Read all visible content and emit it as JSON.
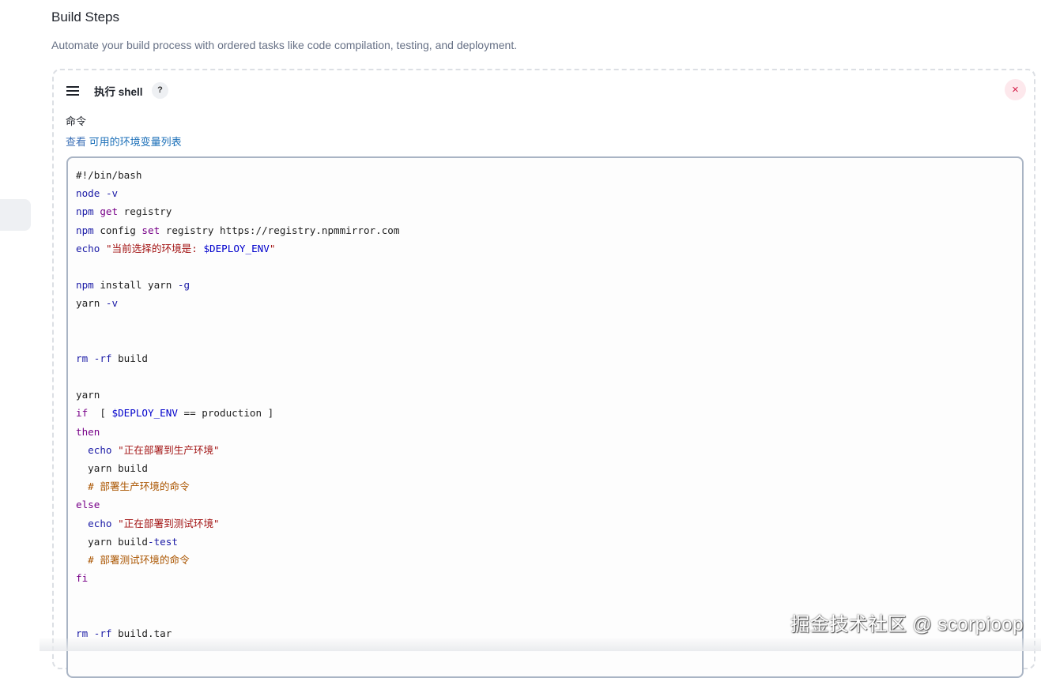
{
  "section": {
    "title": "Build Steps",
    "description": "Automate your build process with ordered tasks like code compilation, testing, and deployment."
  },
  "step": {
    "title": "执行 shell",
    "help_label": "?",
    "close_label": "×",
    "command_label": "命令",
    "env_link_prefix": "查看 ",
    "env_link_text": "可用的环境变量列表"
  },
  "code": {
    "lines": [
      [
        {
          "t": "#!/bin/bash",
          "c": "plain"
        }
      ],
      [
        {
          "t": "node",
          "c": "kw-blue"
        },
        {
          "t": " ",
          "c": "plain"
        },
        {
          "t": "-v",
          "c": "kw-blue"
        }
      ],
      [
        {
          "t": "npm",
          "c": "kw-blue"
        },
        {
          "t": " ",
          "c": "plain"
        },
        {
          "t": "get",
          "c": "kw-purple"
        },
        {
          "t": " registry",
          "c": "plain"
        }
      ],
      [
        {
          "t": "npm",
          "c": "kw-blue"
        },
        {
          "t": " config ",
          "c": "plain"
        },
        {
          "t": "set",
          "c": "kw-purple"
        },
        {
          "t": " registry https://registry.npmmirror.com",
          "c": "plain"
        }
      ],
      [
        {
          "t": "echo",
          "c": "kw-blue"
        },
        {
          "t": " ",
          "c": "plain"
        },
        {
          "t": "\"当前选择的环境是: ",
          "c": "str"
        },
        {
          "t": "$DEPLOY_ENV",
          "c": "var"
        },
        {
          "t": "\"",
          "c": "str"
        }
      ],
      [],
      [
        {
          "t": "npm",
          "c": "kw-blue"
        },
        {
          "t": " install yarn ",
          "c": "plain"
        },
        {
          "t": "-g",
          "c": "kw-blue"
        }
      ],
      [
        {
          "t": "yarn ",
          "c": "plain"
        },
        {
          "t": "-v",
          "c": "kw-blue"
        }
      ],
      [],
      [],
      [
        {
          "t": "rm",
          "c": "kw-blue"
        },
        {
          "t": " ",
          "c": "plain"
        },
        {
          "t": "-rf",
          "c": "kw-blue"
        },
        {
          "t": " build",
          "c": "plain"
        }
      ],
      [],
      [
        {
          "t": "yarn",
          "c": "plain"
        }
      ],
      [
        {
          "t": "if",
          "c": "kw-purple"
        },
        {
          "t": "  [ ",
          "c": "plain"
        },
        {
          "t": "$DEPLOY_ENV",
          "c": "var"
        },
        {
          "t": " == production ]",
          "c": "plain"
        }
      ],
      [
        {
          "t": "then",
          "c": "kw-purple"
        }
      ],
      [
        {
          "t": "  ",
          "c": "plain"
        },
        {
          "t": "echo",
          "c": "kw-blue"
        },
        {
          "t": " ",
          "c": "plain"
        },
        {
          "t": "\"正在部署到生产环境\"",
          "c": "str"
        }
      ],
      [
        {
          "t": "  yarn build",
          "c": "plain"
        }
      ],
      [
        {
          "t": "  ",
          "c": "plain"
        },
        {
          "t": "# 部署生产环境的命令",
          "c": "cmt"
        }
      ],
      [
        {
          "t": "else",
          "c": "kw-purple"
        }
      ],
      [
        {
          "t": "  ",
          "c": "plain"
        },
        {
          "t": "echo",
          "c": "kw-blue"
        },
        {
          "t": " ",
          "c": "plain"
        },
        {
          "t": "\"正在部署到测试环境\"",
          "c": "str"
        }
      ],
      [
        {
          "t": "  yarn build",
          "c": "plain"
        },
        {
          "t": "-test",
          "c": "kw-blue"
        }
      ],
      [
        {
          "t": "  ",
          "c": "plain"
        },
        {
          "t": "# 部署测试环境的命令",
          "c": "cmt"
        }
      ],
      [
        {
          "t": "fi",
          "c": "kw-purple"
        }
      ],
      [],
      [],
      [
        {
          "t": "rm",
          "c": "kw-blue"
        },
        {
          "t": " ",
          "c": "plain"
        },
        {
          "t": "-rf",
          "c": "kw-blue"
        },
        {
          "t": " build.tar",
          "c": "plain"
        }
      ]
    ]
  },
  "watermark": "掘金技术社区 @ scorpioop"
}
